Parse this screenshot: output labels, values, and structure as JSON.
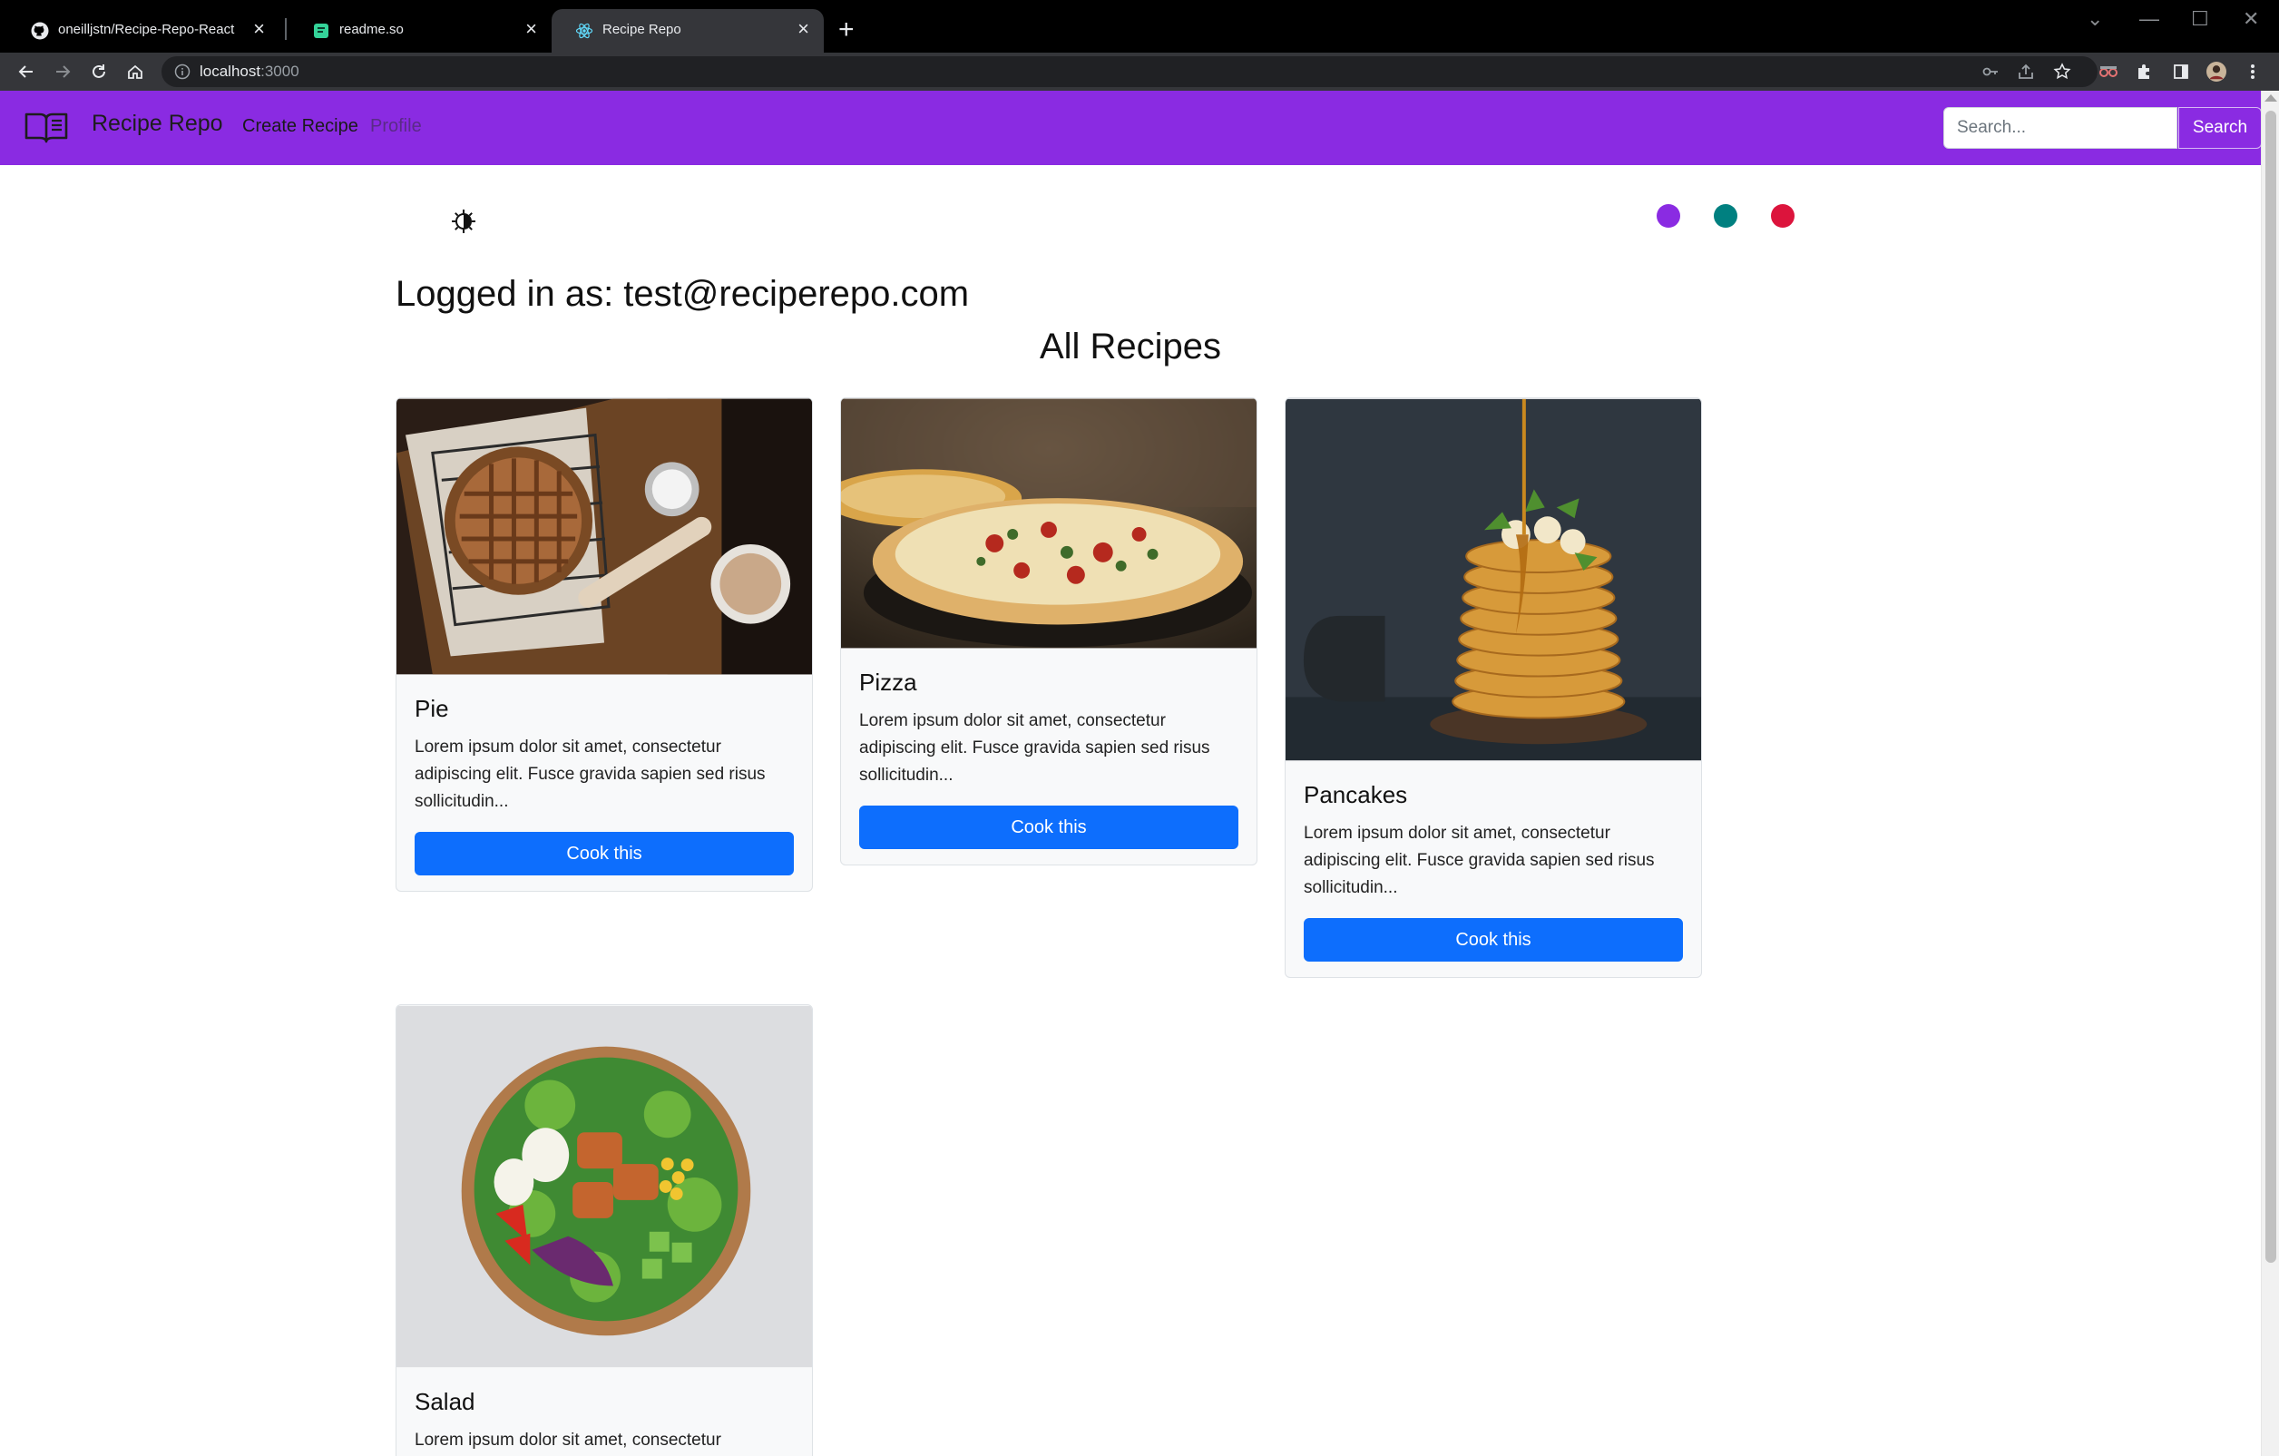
{
  "browser": {
    "tabs": [
      {
        "title": "oneilljstn/Recipe-Repo-React",
        "icon": "github-icon",
        "active": false
      },
      {
        "title": "readme.so",
        "icon": "readme-so-icon",
        "active": false
      },
      {
        "title": "Recipe Repo",
        "icon": "react-icon",
        "active": true
      }
    ],
    "url_host": "localhost",
    "url_port": ":3000"
  },
  "navbar": {
    "brand": "Recipe Repo",
    "links": [
      "Create Recipe",
      "Profile"
    ],
    "search_placeholder": "Search...",
    "search_button": "Search"
  },
  "theme": {
    "colors": [
      "#8a2be2",
      "#008080",
      "#dc143c"
    ]
  },
  "page": {
    "logged_in": "Logged in as: test@reciperepo.com",
    "heading": "All Recipes"
  },
  "recipes": [
    {
      "title": "Pie",
      "text": "Lorem ipsum dolor sit amet, consectetur adipiscing elit. Fusce gravida sapien sed risus sollicitudin...",
      "button": "Cook this"
    },
    {
      "title": "Pizza",
      "text": "Lorem ipsum dolor sit amet, consectetur adipiscing elit. Fusce gravida sapien sed risus sollicitudin...",
      "button": "Cook this"
    },
    {
      "title": "Pancakes",
      "text": "Lorem ipsum dolor sit amet, consectetur adipiscing elit. Fusce gravida sapien sed risus sollicitudin...",
      "button": "Cook this"
    },
    {
      "title": "Salad",
      "text": "Lorem ipsum dolor sit amet, consectetur"
    }
  ]
}
